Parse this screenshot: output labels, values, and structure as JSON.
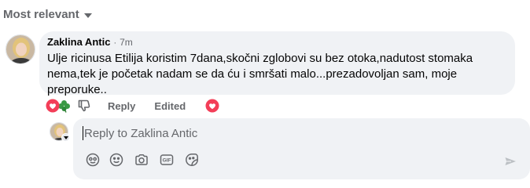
{
  "sort": {
    "label": "Most relevant",
    "icon": "caret-down-icon"
  },
  "comment": {
    "author": "Zaklina Antic",
    "separator": "·",
    "time": "7m",
    "text": "Ulje ricinusa Etilija koristim 7dana,skočni zglobovi su bez otoka,nadutost stomaka nema,tek je početak nadam se da ću i smršati malo...prezadovoljan sam, moje preporuke..",
    "emojis": [
      "♥",
      "🍀"
    ],
    "actions": {
      "reply_label": "Reply",
      "edited_label": "Edited"
    }
  },
  "reply_box": {
    "placeholder": "Reply to Zaklina Antic",
    "tools": [
      "avatar-sticker-icon",
      "emoji-icon",
      "camera-icon",
      "gif-icon",
      "sticker-icon"
    ],
    "send_icon": "send-icon"
  },
  "colors": {
    "bubble_bg": "#f0f2f5",
    "muted_text": "#65676b",
    "love_red": "#f33e58",
    "heart_red": "#e41e3f",
    "clover_green": "#2e8b3a"
  }
}
